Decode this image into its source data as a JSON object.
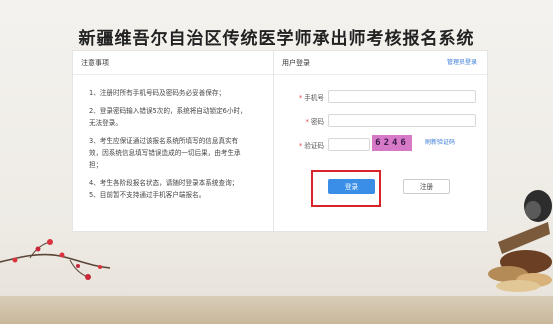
{
  "page": {
    "title": "新疆维吾尔自治区传统医学师承出师考核报名系统"
  },
  "notice": {
    "heading": "注意事项",
    "lines": [
      "1、注册时所有手机号码及密码务必妥善保存；",
      "2、登录密码输入错误5次的，系统将自动锁定6小时，",
      "无法登录。",
      "3、考生应保证通过该报名系统所填写的信息真实有",
      "效，因系统信息填写错误造成的一切后果，由考生承",
      "担；",
      "4、考生各阶段报名状态，请随时登录本系统查询；",
      "5、目前暂不支持通过手机客户端报名。"
    ]
  },
  "login": {
    "heading": "用户登录",
    "admin_link": "管理员登录",
    "phone_label": "手机号",
    "password_label": "密码",
    "captcha_label": "验证码",
    "required_mark": "*",
    "phone_value": "",
    "password_value": "",
    "captcha_value": "",
    "captcha_code": "6246",
    "refresh_link": "刷新验证码",
    "login_button": "登录",
    "register_button": "注册"
  },
  "colors": {
    "accent": "#3a8ee6",
    "link": "#3a7bd5",
    "highlight": "#d8232a",
    "captcha_bg": "#d67ac7"
  }
}
